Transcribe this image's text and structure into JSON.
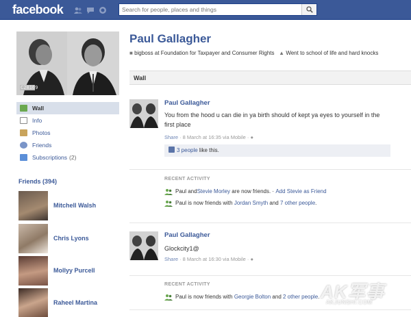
{
  "header": {
    "logo": "facebook",
    "search_placeholder": "Search for people, places and things",
    "jewels": [
      "friend-requests-icon",
      "messages-icon",
      "notifications-icon"
    ]
  },
  "profile": {
    "name": "Paul Gallagher",
    "work_text": "bigboss at Foundation for Taxpayer and Consumer Rights",
    "school_text": "Went to school of life and hard knocks",
    "photo_caption": "C28169"
  },
  "nav": [
    {
      "label": "Wall",
      "icon": "wall-icon",
      "active": true
    },
    {
      "label": "Info",
      "icon": "info-icon"
    },
    {
      "label": "Photos",
      "icon": "photos-icon"
    },
    {
      "label": "Friends",
      "icon": "friends-icon"
    },
    {
      "label": "Subscriptions",
      "icon": "subscriptions-icon",
      "count": "(2)"
    }
  ],
  "friends": {
    "heading": "Friends (394)",
    "list": [
      "Mitchell Walsh",
      "Chris Lyons",
      "Mollyy Purcell",
      "Raheel Martina"
    ]
  },
  "wall": {
    "label": "Wall",
    "posts": [
      {
        "author": "Paul Gallagher",
        "message": "You from the hood u can die in ya birth should of kept ya eyes to yourself in the first place",
        "share": "Share",
        "meta": " · 8 March at 16:35 via Mobile · ",
        "likes_link": "3 people",
        "likes_rest": " like this."
      },
      {
        "author": "Paul Gallagher",
        "message": "Glockcity1@",
        "share": "Share",
        "meta": " · 8 March at 16:30 via Mobile · "
      }
    ],
    "activity_1": {
      "heading": "RECENT ACTIVITY",
      "row1": {
        "a": "Paul and ",
        "link1": "Stevie Morley",
        "b": " are now friends. · ",
        "link2": "Add Stevie as Friend"
      },
      "row2": {
        "a": "Paul is now friends with ",
        "link1": "Jordan Smyth",
        "b": " and ",
        "link2": "7 other people",
        "c": "."
      }
    },
    "activity_2": {
      "heading": "RECENT ACTIVITY",
      "row1": {
        "a": "Paul is now friends with ",
        "link1": "Georgie Bolton",
        "b": " and ",
        "link2": "2 other people",
        "c": "."
      }
    }
  },
  "watermark": {
    "main": "AK军事",
    "sub": "AKJUNSHI.COM"
  },
  "colors": {
    "brand": "#3b5998",
    "link": "#3b5998",
    "active_nav": "#d8dfea"
  }
}
